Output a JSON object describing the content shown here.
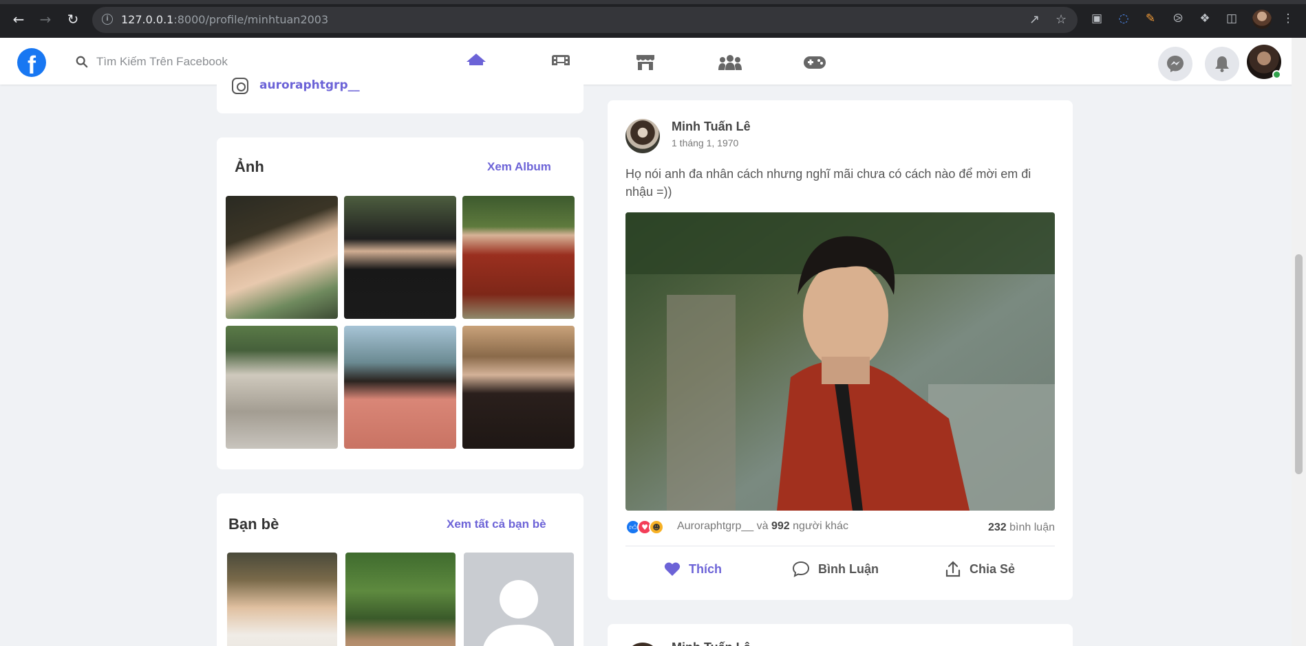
{
  "browser": {
    "url_host": "127.0.0.1",
    "url_rest": ":8000/profile/minhtuan2003",
    "icons": [
      "back-arrow-icon",
      "forward-arrow-icon",
      "reload-icon",
      "site-info-icon",
      "share-icon",
      "bookmark-star-icon",
      "camera-icon",
      "water-drop-icon",
      "color-picker-icon",
      "compass-icon",
      "extensions-icon",
      "side-panel-icon",
      "profile-avatar",
      "more-menu-icon"
    ]
  },
  "header": {
    "logo_letter": "f",
    "search_placeholder": "Tìm Kiếm Trên Facebook",
    "nav": [
      "home-icon",
      "video-icon",
      "marketplace-icon",
      "groups-icon",
      "gaming-icon"
    ],
    "active_nav": "home-icon",
    "accent": "#6c63d7"
  },
  "intro": {
    "instagram": "auroraphtgrp__"
  },
  "photos": {
    "title": "Ảnh",
    "link": "Xem Album"
  },
  "friends": {
    "title": "Bạn bè",
    "link": "Xem tất cả bạn bè"
  },
  "post": {
    "author": "Minh Tuấn Lê",
    "date": "1 tháng 1, 1970",
    "text": "Họ nói anh đa nhân cách nhưng nghĩ mãi chưa có cách nào để mời em đi nhậu =))",
    "reaction_user": "Auroraphtgrp__",
    "reaction_and": "và",
    "reaction_count": "992",
    "reaction_others": "người khác",
    "comment_count": "232",
    "comment_label": "bình luận",
    "like_label": "Thích",
    "comment_button": "Bình Luận",
    "share_label": "Chia Sẻ"
  },
  "post2": {
    "author": "Minh Tuấn Lê"
  }
}
